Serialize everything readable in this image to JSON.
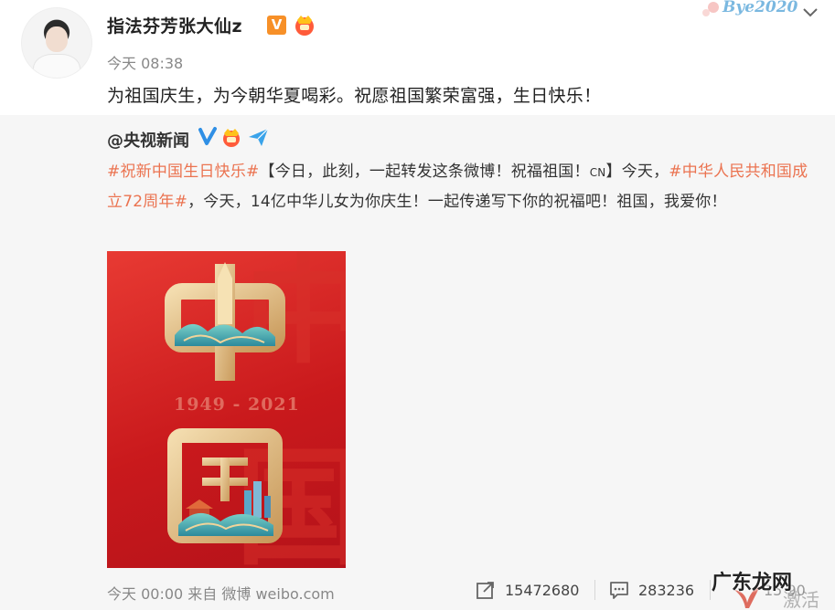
{
  "post": {
    "author": "指法芬芳张大仙z",
    "verified_badge": "V",
    "time": "今天 08:38",
    "text": "为祖国庆生，为今朝华夏喝彩。祝愿祖国繁荣富强，生日快乐！"
  },
  "corner_decoration": {
    "text": "Bye2020"
  },
  "repost": {
    "author": "@央视新闻",
    "segments": {
      "tag1": "#祝新中国生日快乐#",
      "text1": "【今日，此刻，一起转发这条微博！祝福祖国！",
      "cn": "CN",
      "text2": "】今天，",
      "tag2": "#中华人民共和国成立72周年#",
      "text3": "，今天，14亿中华儿女为你庆生！一起传递写下你的祝福吧！祖国，我爱你！"
    },
    "poster": {
      "years": "1949 - 2021"
    },
    "footer": {
      "time_source": "今天 00:00 来自 微博 weibo.com",
      "reposts": "15472680",
      "comments": "283236",
      "likes": "15 90"
    }
  },
  "watermark": {
    "site": "广东龙网",
    "faint": "激活"
  },
  "colors": {
    "tag": "#eb7350",
    "repost_bg": "#f6f6f6",
    "poster_red": "#d42a22",
    "gold": "#e9c388"
  }
}
